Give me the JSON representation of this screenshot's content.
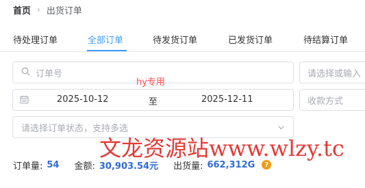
{
  "breadcrumb": {
    "home": "首页",
    "current": "出货订单"
  },
  "tabs": [
    {
      "label": "待处理订单"
    },
    {
      "label": "全部订单"
    },
    {
      "label": "待发货订单"
    },
    {
      "label": "已发货订单"
    },
    {
      "label": "待结算订单"
    }
  ],
  "filters": {
    "order_no_placeholder": "订单号",
    "right_select_1_placeholder": "请选择或输入",
    "date_start": "2025-10-12",
    "date_separator": "至",
    "date_end": "2025-12-11",
    "payment_placeholder": "收款方式",
    "status_placeholder": "请选择订单状态，支持多选"
  },
  "summary": {
    "order_count_label": "订单量:",
    "order_count": "54",
    "amount_label": "金额:",
    "amount": "30,903.54元",
    "shipped_label": "出货量:",
    "shipped": "662,312G",
    "help_glyph": "?"
  },
  "watermarks": {
    "small": "hy专用",
    "big": "文龙资源站www.wlzy.tc"
  },
  "colors": {
    "accent": "#409eff",
    "value": "#2f6bd8",
    "watermark": "#e53935",
    "help": "#f39c12"
  }
}
